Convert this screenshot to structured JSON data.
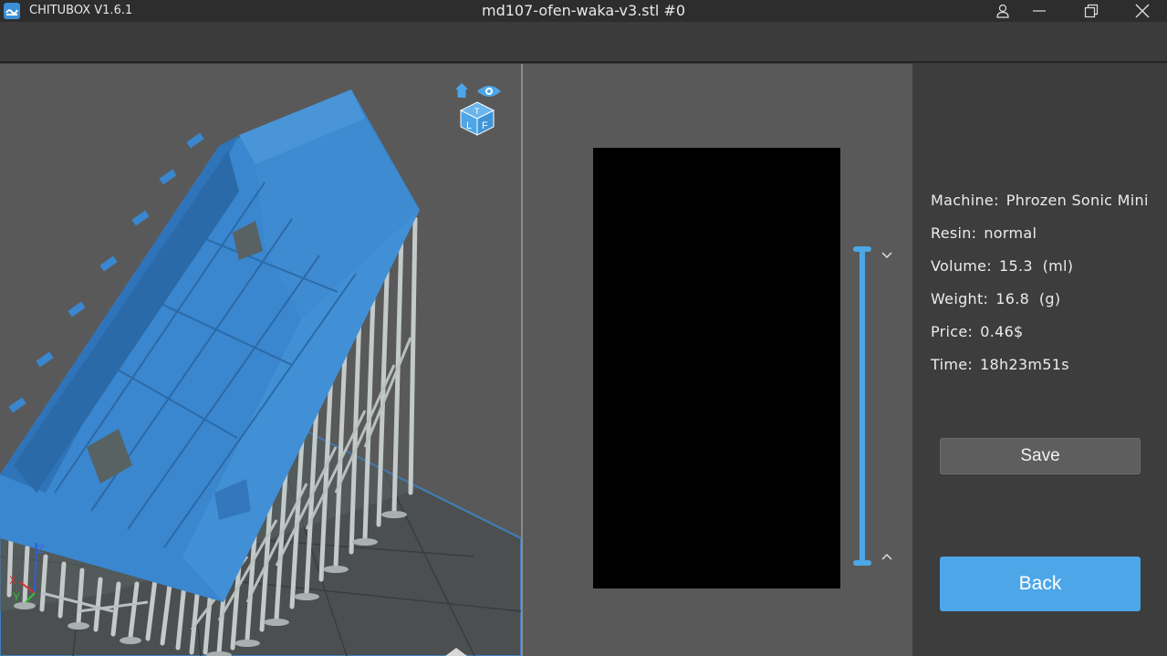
{
  "app": {
    "name": "CHITUBOX V1.6.1",
    "window_title": "md107-ofen-waka-v3.stl #0"
  },
  "colors": {
    "accent": "#4da6e8",
    "model_blue": "#3a86cf",
    "support_gray": "#c9cfcf",
    "layer_image": "#000000"
  },
  "view_cube": {
    "faces": [
      "T",
      "L",
      "F"
    ]
  },
  "axes": {
    "x": "X",
    "y": "Y",
    "z": "Z"
  },
  "info": {
    "machine": {
      "label": "Machine:",
      "value": "Phrozen Sonic Mini"
    },
    "resin": {
      "label": "Resin:",
      "value": "normal"
    },
    "volume": {
      "label": "Volume:",
      "value": "15.3  (ml)"
    },
    "weight": {
      "label": "Weight:",
      "value": "16.8  (g)"
    },
    "price": {
      "label": "Price:",
      "value": "0.46$"
    },
    "time": {
      "label": "Time:",
      "value": "18h23m51s"
    }
  },
  "buttons": {
    "save": "Save",
    "back": "Back"
  },
  "icons": {
    "app_logo": "chitubox-logo-icon",
    "account": "user-icon",
    "minimize": "minimize-icon",
    "restore": "restore-icon",
    "close": "close-icon",
    "home": "home-icon",
    "eye": "eye-icon",
    "layer_down": "chevron-down-icon",
    "layer_up": "chevron-up-icon"
  }
}
